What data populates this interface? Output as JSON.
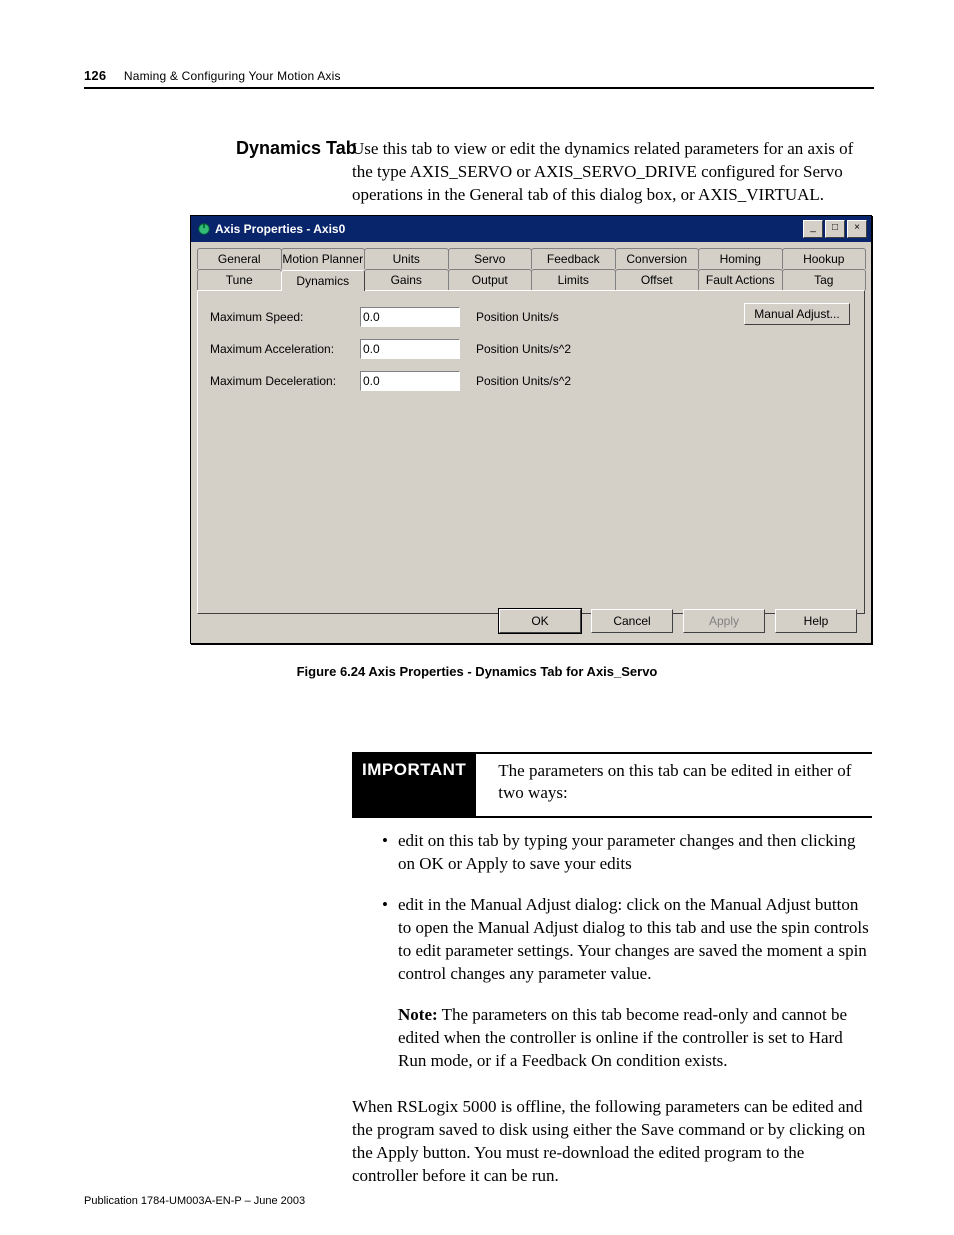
{
  "header": {
    "page_number": "126",
    "chapter": "Naming & Configuring Your Motion Axis"
  },
  "section_title": "Dynamics Tab",
  "intro": "Use this tab to view or edit the dynamics related parameters for an axis of the type AXIS_SERVO or AXIS_SERVO_DRIVE configured for Servo operations in the General tab of this dialog box, or AXIS_VIRTUAL.",
  "dialog": {
    "title": "Axis Properties - Axis0",
    "titlebar_buttons": {
      "min": "_",
      "max": "□",
      "close": "×"
    },
    "tabs_row1": [
      "General",
      "Motion Planner",
      "Units",
      "Servo",
      "Feedback",
      "Conversion",
      "Homing",
      "Hookup"
    ],
    "tabs_row2": [
      "Tune",
      "Dynamics",
      "Gains",
      "Output",
      "Limits",
      "Offset",
      "Fault Actions",
      "Tag"
    ],
    "active_tab": "Dynamics",
    "fields": [
      {
        "label": "Maximum Speed:",
        "value": "0.0",
        "unit": "Position Units/s"
      },
      {
        "label": "Maximum Acceleration:",
        "value": "0.0",
        "unit": "Position Units/s^2"
      },
      {
        "label": "Maximum Deceleration:",
        "value": "0.0",
        "unit": "Position Units/s^2"
      }
    ],
    "manual_adjust": "Manual Adjust...",
    "buttons": {
      "ok": "OK",
      "cancel": "Cancel",
      "apply": "Apply",
      "help": "Help"
    }
  },
  "figure_caption": "Figure 6.24 Axis Properties - Dynamics Tab for Axis_Servo",
  "important": {
    "label": "IMPORTANT",
    "text": "The parameters on this tab can be edited in either of two ways:"
  },
  "bullets": [
    "edit on this tab by typing your parameter changes and then clicking on OK or Apply to save your edits",
    "edit in the Manual Adjust dialog: click on the Manual Adjust button to open the Manual Adjust dialog to this tab and use the spin controls to edit parameter settings. Your changes are saved the moment a spin control changes any parameter value."
  ],
  "note_label": "Note:",
  "note_text": " The parameters on this tab become read-only and cannot be edited when the controller is online if the controller is set to Hard Run mode, or if a Feedback On condition exists.",
  "closing": "When RSLogix 5000 is offline, the following parameters can be edited and the program saved to disk using either the Save command or by clicking on the Apply button. You must re-download the edited program to the controller before it can be run.",
  "footer": "Publication 1784-UM003A-EN-P – June 2003"
}
